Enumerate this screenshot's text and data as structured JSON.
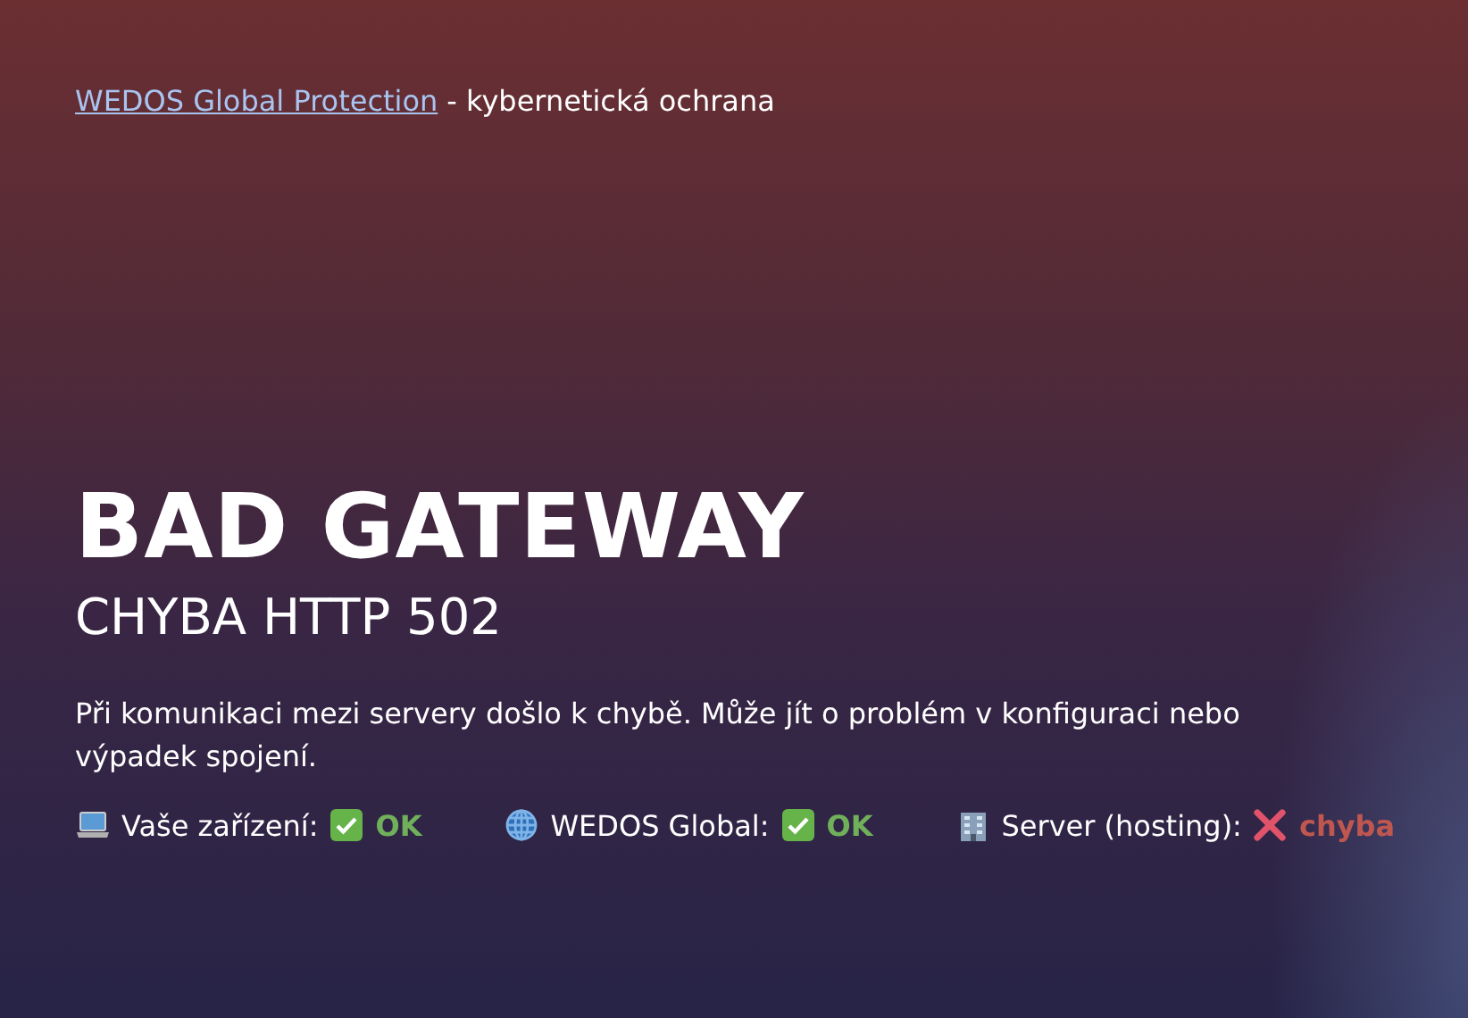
{
  "header": {
    "link": "WEDOS Global Protection",
    "suffix": "- kybernetická ochrana"
  },
  "title": "BAD GATEWAY",
  "subtitle": "CHYBA HTTP 502",
  "message": "Při komunikaci mezi servery došlo k chybě. Může jít o problém v konfiguraci nebo výpadek spojení.",
  "statuses": [
    {
      "label": "Vaše zařízení:",
      "kind": "ok",
      "status": "OK"
    },
    {
      "label": "WEDOS Global:",
      "kind": "ok",
      "status": "OK"
    },
    {
      "label": "Server (hosting):",
      "kind": "error",
      "status": "chyba"
    }
  ]
}
